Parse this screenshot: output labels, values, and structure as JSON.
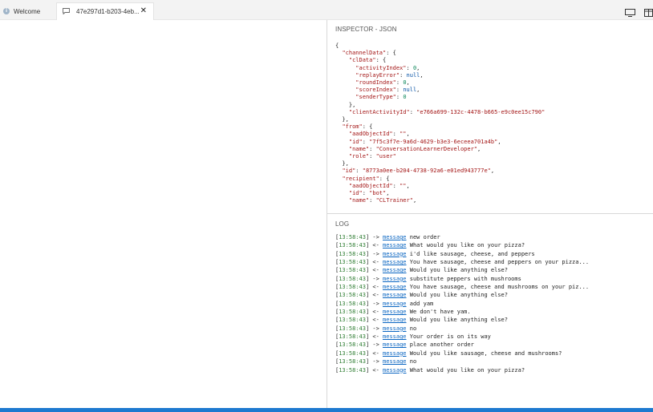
{
  "tabs": [
    {
      "label": "Welcome"
    },
    {
      "label": "47e297d1-b203-4eb..."
    }
  ],
  "inspector": {
    "title": "INSPECTOR - JSON",
    "json_lines": [
      "{",
      "  \"channelData\": {",
      "    \"clData\": {",
      "      \"activityIndex\": 0,",
      "      \"replayError\": null,",
      "      \"roundIndex\": 0,",
      "      \"scoreIndex\": null,",
      "      \"senderType\": 0",
      "    },",
      "    \"clientActivityId\": \"e766a699-132c-4478-b665-e9c0ee15c790\"",
      "  },",
      "  \"from\": {",
      "    \"aadObjectId\": \"\",",
      "    \"id\": \"7f5c3f7e-9a6d-4629-b3e3-6eceea701a4b\",",
      "    \"name\": \"ConversationLearnerDeveloper\",",
      "    \"role\": \"user\"",
      "  },",
      "  \"id\": \"8773a0ee-b204-4738-92a6-e01ed943777e\",",
      "  \"recipient\": {",
      "    \"aadObjectId\": \"\",",
      "    \"id\": \"bot\",",
      "    \"name\": \"CLTrainer\","
    ]
  },
  "log": {
    "title": "LOG",
    "link_label": "message",
    "entries": [
      {
        "time": "13:58:43",
        "dir": "->",
        "text": "new order"
      },
      {
        "time": "13:58:43",
        "dir": "<-",
        "text": "What would you like on your pizza?"
      },
      {
        "time": "13:58:43",
        "dir": "->",
        "text": "i'd like sausage, cheese, and peppers"
      },
      {
        "time": "13:58:43",
        "dir": "<-",
        "text": "You have sausage, cheese and peppers on your pizza..."
      },
      {
        "time": "13:58:43",
        "dir": "<-",
        "text": "Would you like anything else?"
      },
      {
        "time": "13:58:43",
        "dir": "->",
        "text": "substitute peppers with mushrooms"
      },
      {
        "time": "13:58:43",
        "dir": "<-",
        "text": "You have sausage, cheese and mushrooms on your piz..."
      },
      {
        "time": "13:58:43",
        "dir": "<-",
        "text": "Would you like anything else?"
      },
      {
        "time": "13:58:43",
        "dir": "->",
        "text": "add yam"
      },
      {
        "time": "13:58:43",
        "dir": "<-",
        "text": "We don't have yam."
      },
      {
        "time": "13:58:43",
        "dir": "<-",
        "text": "Would you like anything else?"
      },
      {
        "time": "13:58:43",
        "dir": "->",
        "text": "no"
      },
      {
        "time": "13:58:43",
        "dir": "<-",
        "text": "Your order is on its way"
      },
      {
        "time": "13:58:43",
        "dir": "->",
        "text": "place another order"
      },
      {
        "time": "13:58:43",
        "dir": "<-",
        "text": "Would you like sausage, cheese and mushrooms?"
      },
      {
        "time": "13:58:43",
        "dir": "->",
        "text": "no"
      },
      {
        "time": "13:58:43",
        "dir": "<-",
        "text": "What would you like on your pizza?"
      }
    ]
  },
  "icons": {
    "welcome_tab": "info-icon",
    "conversation_tab": "chat-icon",
    "close": "close-icon",
    "tool_1": "monitor-icon",
    "tool_2": "split-layout-icon"
  },
  "colors": {
    "accent": "#1e7ad0",
    "link": "#0b66c2",
    "timestamp": "#2e7d32",
    "json_string": "#a31515",
    "json_number": "#098658",
    "json_null": "#0451a5"
  }
}
